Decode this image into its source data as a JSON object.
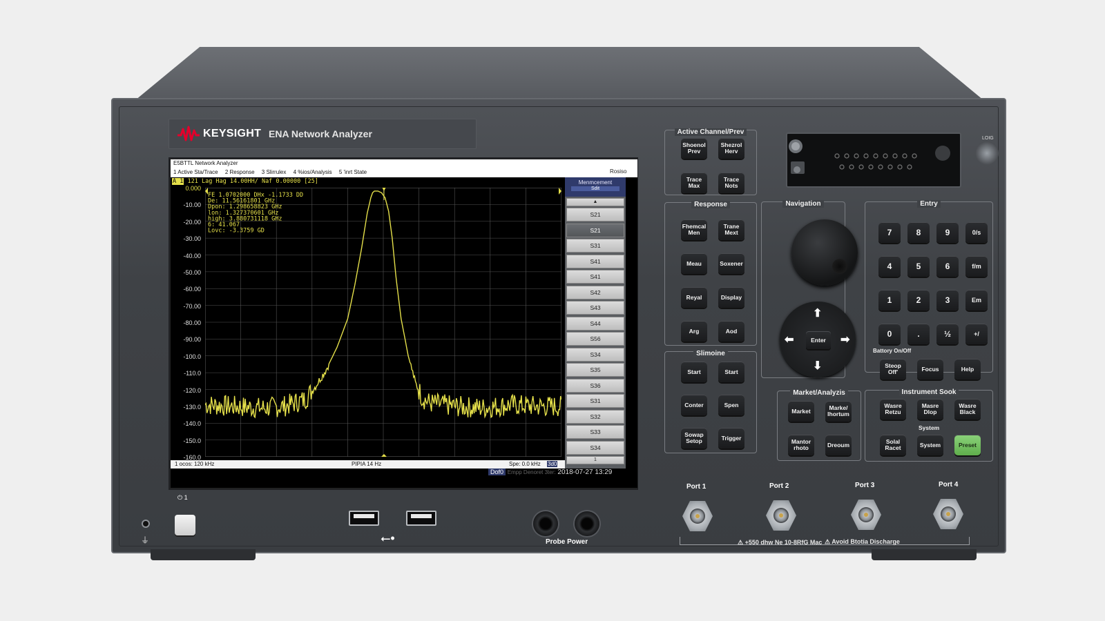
{
  "brand": {
    "name": "KEYSIGHT",
    "model": "ENA Network Analyzer"
  },
  "screen": {
    "window_title": "E5BTTL Network Analyzer",
    "menu": [
      "1 Active Sta/Trace",
      "2 Response",
      "3 Slirrulex",
      "4 %ios/Analysis",
      "5 'inrt State"
    ],
    "menu_right": "Rosiso",
    "trace_tag": "A 1",
    "trace_status": "121 Lag Hag 14.00HH/ Naf 0.00000 [25]",
    "marker_readout": [
      "FE  1.0702000 DHx -1.1733 DD",
      "  De:  11.56161801 GHz",
      "Dpon:  1.298658823 GHz",
      "  lon:  1.327370601 GHz",
      "high:  3.880731118 GHz",
      "    6:  41.067",
      "Lovc: -3.3759 GD"
    ],
    "bottom_left": "1 ocos: 120 kHz",
    "bottom_center": "PIPIA 14 Hz",
    "bottom_right": "Spe: 0.0 kHz",
    "bottom_chip": "3d0",
    "softkey_title": "Menmcement",
    "softkey_sub": "Sdit",
    "softkey_up": "▲",
    "softkey_down": "1",
    "softkeys": [
      "S21",
      "S21",
      "S31",
      "S41",
      "S41",
      "S42",
      "S43",
      "S44",
      "S56",
      "S34",
      "S35",
      "S36",
      "S31",
      "S32",
      "S33",
      "S34"
    ],
    "status_chip": "Dof0",
    "status_dim": "Empp Denoret 3ter:",
    "status_time": "2018-07-27 13:29"
  },
  "chart_data": {
    "type": "line",
    "yticks": [
      "0.000",
      "-10.00",
      "-20.00",
      "-30.00",
      "-40.00",
      "-50.00",
      "-60.00",
      "-70.00",
      "-80.00",
      "-90.00",
      "-100.0",
      "-110.0",
      "-120.0",
      "-130.0",
      "-140.0",
      "-150.0",
      "-160.0"
    ],
    "ylim": [
      -160,
      0
    ],
    "grid": true,
    "trace_color": "#e5e04a",
    "trace": {
      "x": [
        0.0,
        0.08,
        0.16,
        0.22,
        0.28,
        0.31,
        0.34,
        0.37,
        0.4,
        0.42,
        0.44,
        0.455,
        0.465,
        0.47,
        0.475,
        0.485,
        0.495,
        0.505,
        0.515,
        0.525,
        0.535,
        0.55,
        0.57,
        0.59,
        0.61,
        0.63,
        0.7,
        0.78,
        0.86,
        0.93,
        1.0
      ],
      "y": [
        -129,
        -130,
        -131,
        -130,
        -126,
        -118,
        -108,
        -95,
        -78,
        -58,
        -35,
        -15,
        -6,
        -3,
        -2,
        -2,
        -3,
        -6,
        -14,
        -30,
        -52,
        -78,
        -100,
        -116,
        -125,
        -128,
        -130,
        -131,
        -129,
        -130,
        -130
      ],
      "noise": 4
    }
  },
  "panel": {
    "active_channel": {
      "title": "Active Channel/Prev",
      "keys": [
        "Shoenol Prev",
        "Shezrol Herv",
        "Trace Max",
        "Trace Nots"
      ]
    },
    "response": {
      "title": "Response",
      "keys": [
        "Fhemcal Men",
        "Trane Mext",
        "Meau",
        "Soxener",
        "Reyal",
        "Display",
        "Arg",
        "Aod"
      ]
    },
    "stimulus": {
      "title": "Slimoine",
      "keys": [
        "Start",
        "Start",
        "Conter",
        "Spen",
        "Sowap Setop",
        "Trigger"
      ]
    },
    "navigation": {
      "title": "Navigation",
      "enter": "Enter",
      "up": "⬆",
      "down": "⬇",
      "left": "⬅",
      "right": "➡"
    },
    "entry": {
      "title": "Entry",
      "keys": [
        "7",
        "8",
        "9",
        "0/s",
        "4",
        "5",
        "6",
        "f/m",
        "1",
        "2",
        "3",
        "Em",
        "0",
        ".",
        "½",
        "+/"
      ],
      "battery_label": "Battory On/Off",
      "function_keys": [
        "Steop Off'",
        "Focus",
        "Help"
      ]
    },
    "market": {
      "title": "Market/Analyzis",
      "keys": [
        "Market",
        "Marke/ Ihortum",
        "Mantor rhoto",
        "Dreoum"
      ]
    },
    "instrument": {
      "title": "Instrument Sook",
      "keys": [
        "Wasre Retzu",
        "Masre Dlop",
        "Wasre Black"
      ],
      "system_label": "System",
      "system_keys": [
        "Solal Racet",
        "System",
        "Preset"
      ]
    },
    "ports": [
      "Port 1",
      "Port 2",
      "Port 3",
      "Port 4"
    ],
    "port_warning": "+550 dhw Ne 10-8RfG Mac",
    "esd_warning": "Avoid Btotia Discharge",
    "io_label": "LOIG",
    "probe_label": "Probe Power",
    "power_symbol": "⏻ 1"
  }
}
